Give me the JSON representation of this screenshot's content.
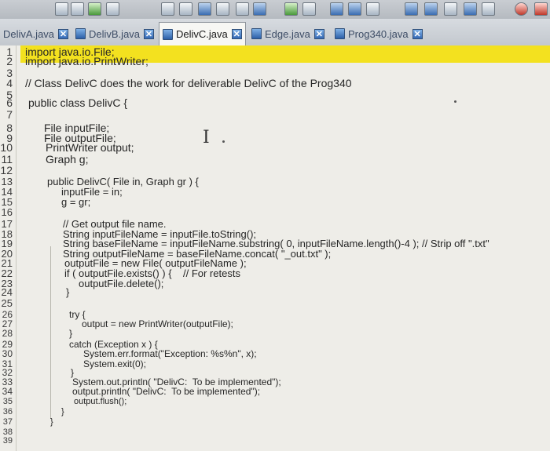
{
  "tabs": [
    {
      "label": "DelivA.java",
      "active": false
    },
    {
      "label": "DelivB.java",
      "active": false
    },
    {
      "label": "DelivC.java",
      "active": true
    },
    {
      "label": "Edge.java",
      "active": false
    },
    {
      "label": "Prog340.java",
      "active": false
    }
  ],
  "tab_close_glyph": "✕",
  "cursor_glyph": "I",
  "code_lines": [
    {
      "n": "1",
      "text": "import java.io.File;"
    },
    {
      "n": "2",
      "text": "import java.io.PrintWriter;"
    },
    {
      "n": "3",
      "text": ""
    },
    {
      "n": "4",
      "text": "// Class DelivC does the work for deliverable DelivC of the Prog340"
    },
    {
      "n": "5",
      "text": ""
    },
    {
      "n": "6",
      "text": "public class DelivC {"
    },
    {
      "n": "7",
      "text": ""
    },
    {
      "n": "8",
      "text": "File inputFile;"
    },
    {
      "n": "9",
      "text": "File outputFile;"
    },
    {
      "n": "10",
      "text": "PrintWriter output;"
    },
    {
      "n": "11",
      "text": "Graph g;"
    },
    {
      "n": "12",
      "text": ""
    },
    {
      "n": "13",
      "text": "public DelivC( File in, Graph gr ) {"
    },
    {
      "n": "14",
      "text": "inputFile = in;"
    },
    {
      "n": "15",
      "text": "g = gr;"
    },
    {
      "n": "16",
      "text": ""
    },
    {
      "n": "17",
      "text": "// Get output file name."
    },
    {
      "n": "18",
      "text": "String inputFileName = inputFile.toString();"
    },
    {
      "n": "19",
      "text": "String baseFileName = inputFileName.substring( 0, inputFileName.length()-4 ); // Strip off \".txt\""
    },
    {
      "n": "20",
      "text": "String outputFileName = baseFileName.concat( \"_out.txt\" );"
    },
    {
      "n": "21",
      "text": "outputFile = new File( outputFileName );"
    },
    {
      "n": "22",
      "text": "if ( outputFile.exists() ) {    // For retests"
    },
    {
      "n": "23",
      "text": "outputFile.delete();"
    },
    {
      "n": "24",
      "text": "}"
    },
    {
      "n": "25",
      "text": ""
    },
    {
      "n": "26",
      "text": "try {"
    },
    {
      "n": "27",
      "text": "output = new PrintWriter(outputFile);"
    },
    {
      "n": "28",
      "text": "}"
    },
    {
      "n": "29",
      "text": "catch (Exception x ) {"
    },
    {
      "n": "30",
      "text": "System.err.format(\"Exception: %s%n\", x);"
    },
    {
      "n": "31",
      "text": "System.exit(0);"
    },
    {
      "n": "32",
      "text": "}"
    },
    {
      "n": "33",
      "text": "System.out.println( \"DelivC:  To be implemented\");"
    },
    {
      "n": "34",
      "text": "output.println( \"DelivC:  To be implemented\");"
    },
    {
      "n": "35",
      "text": "output.flush();"
    },
    {
      "n": "36",
      "text": "}"
    },
    {
      "n": "37",
      "text": "}"
    },
    {
      "n": "38",
      "text": ""
    },
    {
      "n": "39",
      "text": ""
    }
  ]
}
